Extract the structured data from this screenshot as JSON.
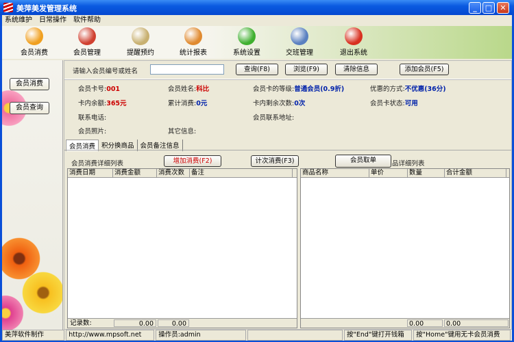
{
  "window": {
    "title": "美萍美发管理系统"
  },
  "menu": [
    "系统维护",
    "日常操作",
    "软件帮助"
  ],
  "toolbar": [
    {
      "label": "会员消费",
      "icon": "forward-icon",
      "color": "#f0a020"
    },
    {
      "label": "会员管理",
      "icon": "member-warning-icon",
      "color": "#d04030"
    },
    {
      "label": "提醒预约",
      "icon": "calendar-icon",
      "color": "#c8b070"
    },
    {
      "label": "统计报表",
      "icon": "report-icon",
      "color": "#e08a30"
    },
    {
      "label": "系统设置",
      "icon": "blocks-icon",
      "color": "#40b030"
    },
    {
      "label": "交班管理",
      "icon": "exchange-icon",
      "color": "#5a80c0"
    },
    {
      "label": "退出系统",
      "icon": "exit-icon",
      "color": "#d83020"
    }
  ],
  "sidebar": {
    "btn1": "会员消费",
    "btn2": "会员查询"
  },
  "search": {
    "label": "请输入会员编号或姓名",
    "value": "",
    "query": "查询(F8)",
    "browse": "浏览(F9)",
    "clear": "清除信息",
    "add": "添加会员(F5)"
  },
  "info": {
    "card_no_l": "会员卡号:",
    "card_no": "001",
    "name_l": "会员姓名:",
    "name": "科比",
    "level_l": "会员卡的等级:",
    "level": "普通会员(0.9折)",
    "discount_l": "优惠的方式:",
    "discount": "不优惠(36分)",
    "balance_l": "卡内余额:",
    "balance": "365元",
    "total_l": "累计消费:",
    "total": "0元",
    "remain_l": "卡内剩余次数:",
    "remain": "0次",
    "status_l": "会员卡状态:",
    "status": "可用",
    "phone_l": "联系电话:",
    "addr_l": "会员联系地址:",
    "photo_l": "会员照片:",
    "other_l": "其它信息:"
  },
  "tabs": [
    "会员消费",
    "积分换商品",
    "会员备注信息"
  ],
  "sub": {
    "list_title": "会员消费详细列表",
    "add": "增加消费(F2)",
    "count": "计次消费(F3)",
    "order": "会员取单",
    "right_title": "品详细列表"
  },
  "left_grid": {
    "cols": [
      "消费日期",
      "消费金额",
      "消费次数",
      "备注"
    ],
    "footer": [
      "记录数:",
      "0.00",
      "0.00"
    ]
  },
  "right_grid": {
    "cols": [
      "商品名称",
      "单价",
      "数量",
      "合计金额"
    ],
    "footer": [
      "0.00",
      "0.00"
    ]
  },
  "status": [
    "美萍软件制作",
    "http://www.mpsoft.net",
    "操作员:admin",
    "",
    "按\"End\"键打开钱箱",
    "按\"Home\"键用无卡会员消费"
  ]
}
